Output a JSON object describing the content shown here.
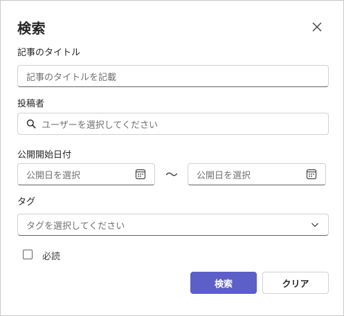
{
  "dialog": {
    "title": "検索",
    "close_icon": "close-icon"
  },
  "article_title": {
    "label": "記事のタイトル",
    "placeholder": "記事のタイトルを記載"
  },
  "author": {
    "label": "投稿者",
    "placeholder": "ユーザーを選択してください",
    "icon": "search-icon"
  },
  "publish_date": {
    "label": "公開開始日付",
    "start_placeholder": "公開日を選択",
    "separator": "～",
    "end_placeholder": "公開日を選択",
    "icon": "calendar-icon"
  },
  "tags": {
    "label": "タグ",
    "placeholder": "タグを選択してください",
    "icon": "chevron-down-icon"
  },
  "required_reading": {
    "label": "必読",
    "checked": false
  },
  "buttons": {
    "search": "検索",
    "clear": "クリア"
  },
  "colors": {
    "primary": "#5b5fc7",
    "border": "#d1d1d1",
    "text": "#242424"
  }
}
